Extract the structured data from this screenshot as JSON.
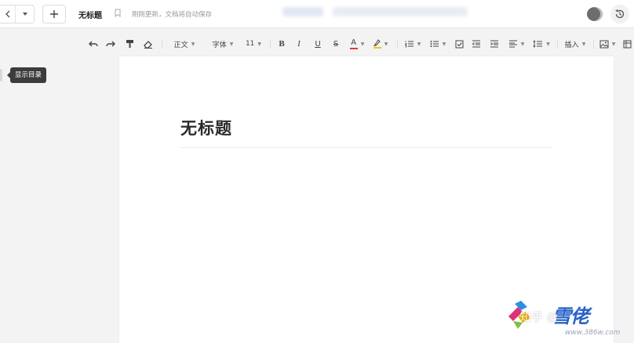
{
  "header": {
    "doc_title": "无标题",
    "save_status": "刚刚更新，文档将自动保存"
  },
  "toolbar": {
    "paragraph_style": "正文",
    "font_family": "字体",
    "font_size": "11",
    "insert_label": "插入",
    "bold_label": "B",
    "italic_label": "I",
    "underline_label": "U",
    "strike_label": "S",
    "font_color_label": "A",
    "font_color": "#e53935",
    "highlight_color": "#f5c518"
  },
  "sidebar": {
    "toc_tooltip": "显示目录"
  },
  "page": {
    "title": "无标题"
  },
  "watermark": {
    "zhihu": "知乎 @",
    "brand": "雪佬",
    "site": "www.386w.com"
  },
  "colors": {
    "page_bg": "#ffffff",
    "workspace_bg": "#f3f3f3",
    "tooltip_bg": "#3c3c3c"
  }
}
